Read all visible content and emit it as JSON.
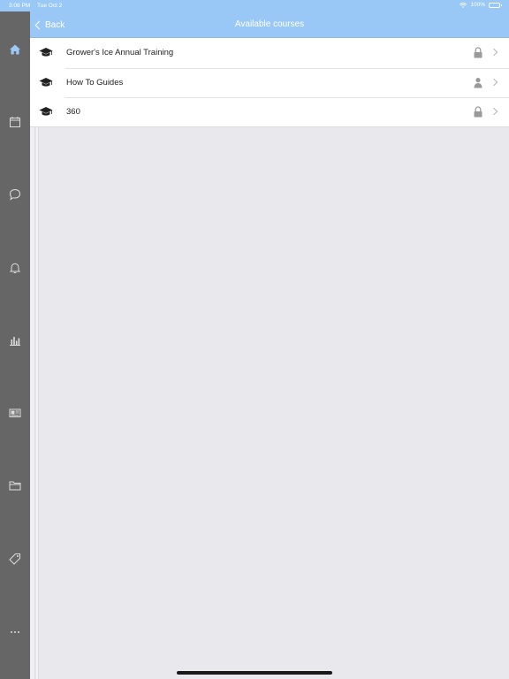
{
  "status_bar": {
    "time": "3:08 PM",
    "date": "Tue Oct 2",
    "battery": "100%"
  },
  "nav": {
    "back_label": "Back",
    "title": "Available courses"
  },
  "colors": {
    "header": "#99c8f6",
    "sidebar": "#666666",
    "background": "#e9e8ec"
  },
  "sidebar": {
    "items": [
      {
        "icon": "home-icon",
        "active": true
      },
      {
        "icon": "calendar-icon"
      },
      {
        "icon": "chat-icon"
      },
      {
        "icon": "bell-icon"
      },
      {
        "icon": "bar-chart-icon"
      },
      {
        "icon": "newspaper-icon"
      },
      {
        "icon": "folder-icon"
      },
      {
        "icon": "tag-icon"
      },
      {
        "icon": "more-icon"
      }
    ]
  },
  "courses": [
    {
      "title": "Grower's Ice Annual Training",
      "status_icon": "lock-icon"
    },
    {
      "title": "How To Guides",
      "status_icon": "person-icon"
    },
    {
      "title": "360",
      "status_icon": "lock-icon"
    }
  ]
}
